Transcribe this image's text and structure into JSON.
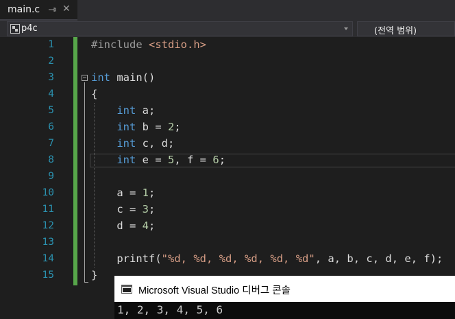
{
  "tab": {
    "title": "main.c"
  },
  "navbar": {
    "project": "p4c",
    "scope": "(전역 범위)"
  },
  "editor": {
    "line_numbers": [
      "1",
      "2",
      "3",
      "4",
      "5",
      "6",
      "7",
      "8",
      "9",
      "10",
      "11",
      "12",
      "13",
      "14",
      "15"
    ]
  },
  "console": {
    "title": "Microsoft Visual Studio 디버그 콘솔",
    "output": "1, 2, 3, 4, 5, 6"
  },
  "colors": {
    "keyword": "#569cd6",
    "line_number": "#2b91af",
    "string": "#d69d85",
    "number": "#b5cea8",
    "change_bar": "#57a64a"
  }
}
